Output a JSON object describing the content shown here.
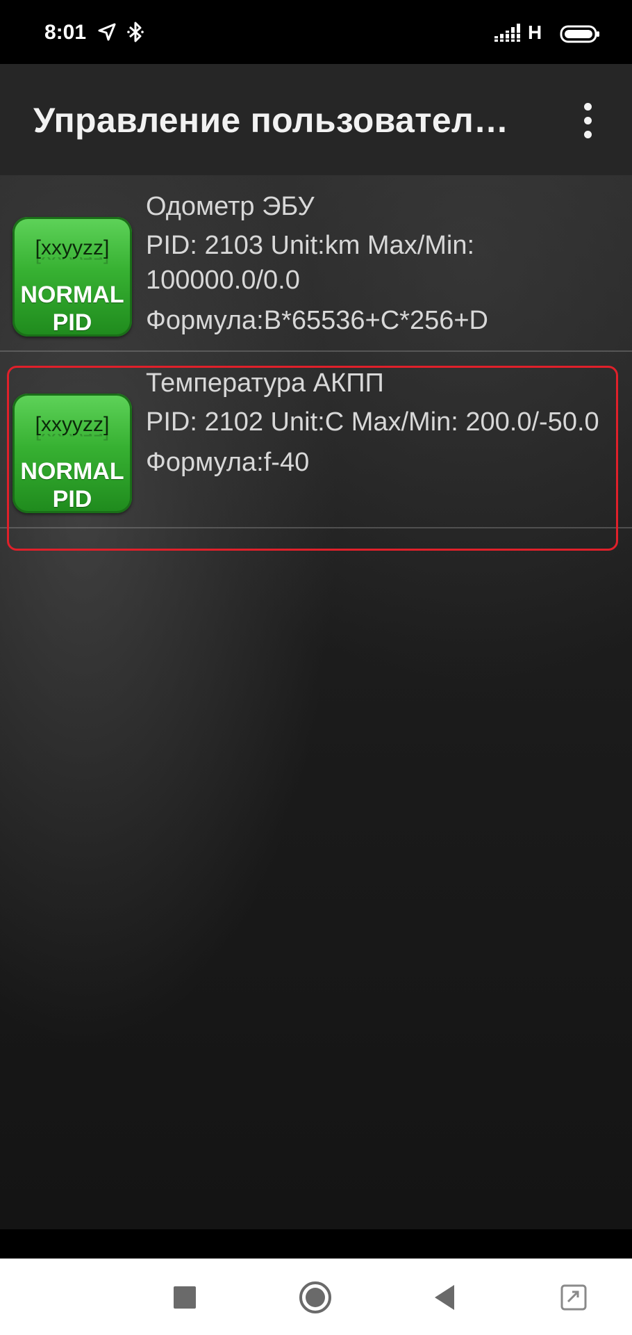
{
  "status_bar": {
    "time": "8:01",
    "network_type": "H",
    "icons": [
      "navigation-arrow-icon",
      "bluetooth-icon",
      "signal-icon",
      "battery-icon"
    ]
  },
  "app_bar": {
    "title": "Управление пользовател…",
    "overflow_icon": "more-vert-icon"
  },
  "pid_items": [
    {
      "badge_code": "[xxyyzz]",
      "badge_type_line1": "NORMAL",
      "badge_type_line2": "PID",
      "name": "Одометр ЭБУ",
      "details": "PID: 2103  Unit:km Max/Min: 100000.0/0.0",
      "formula": "Формула:B*65536+C*256+D"
    },
    {
      "badge_code": "[xxyyzz]",
      "badge_type_line1": "NORMAL",
      "badge_type_line2": "PID",
      "name": "Температура АКПП",
      "details": "PID: 2102  Unit:C Max/Min: 200.0/-50.0",
      "formula": "Формула:f-40"
    }
  ],
  "highlight": {
    "color": "#e0202a",
    "target": "pid_items.1"
  },
  "nav_bar": {
    "buttons": [
      "recent-apps-icon",
      "home-icon",
      "back-icon",
      "assistant-icon"
    ]
  },
  "colors": {
    "badge_green": "#37b132",
    "app_bar_bg": "#262626",
    "text_primary": "#d8d8d8"
  }
}
